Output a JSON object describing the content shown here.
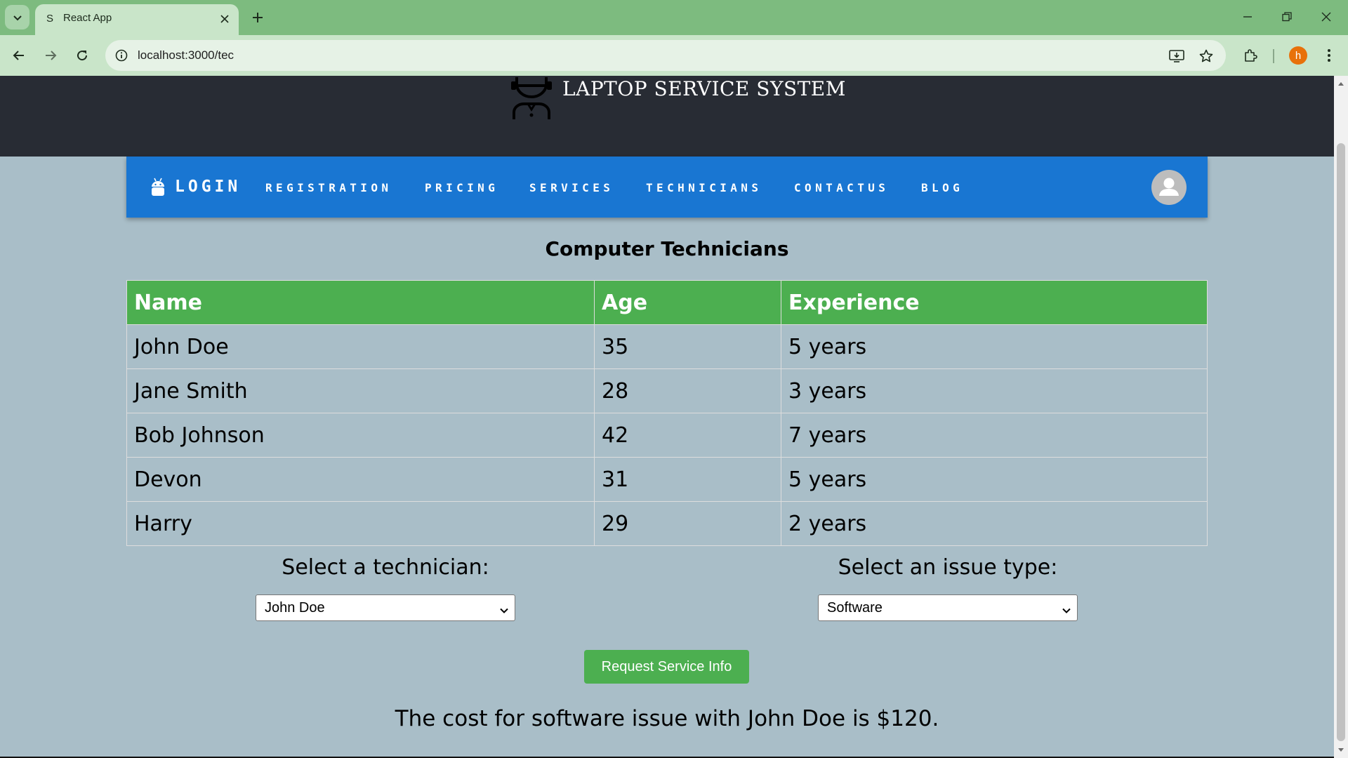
{
  "browser": {
    "tab_title": "React App",
    "tab_favicon": "S",
    "url": "localhost:3000/tec",
    "profile_initial": "h"
  },
  "site": {
    "title": "LAPTOP SERVICE SYSTEM"
  },
  "nav": {
    "login": "LOGIN",
    "links": [
      "REGISTRATION",
      "PRICING",
      "SERVICES",
      "TECHNICIANS",
      "CONTACTUS",
      "BLOG"
    ]
  },
  "page": {
    "heading": "Computer Technicians",
    "table": {
      "headers": [
        "Name",
        "Age",
        "Experience"
      ],
      "rows": [
        [
          "John Doe",
          "35",
          "5 years"
        ],
        [
          "Jane Smith",
          "28",
          "3 years"
        ],
        [
          "Bob Johnson",
          "42",
          "7 years"
        ],
        [
          "Devon",
          "31",
          "5 years"
        ],
        [
          "Harry",
          "29",
          "2 years"
        ]
      ]
    },
    "technician_label": "Select a technician:",
    "technician_selected": "John Doe",
    "issue_label": "Select an issue type:",
    "issue_selected": "Software",
    "request_button": "Request Service Info",
    "result_text": "The cost for software issue with John Doe is $120."
  },
  "colors": {
    "chrome_tabstrip": "#7dbb7f",
    "chrome_toolbar": "#c9e5c9",
    "header_bg": "#282c34",
    "navbar_bg": "#1976d2",
    "table_header_bg": "#4caf50",
    "page_bg": "#a9bec8",
    "button_bg": "#4caf50"
  },
  "icons": [
    "tab-search-icon",
    "close-icon",
    "plus-icon",
    "minimize-icon",
    "restore-icon",
    "back-icon",
    "forward-icon",
    "reload-icon",
    "site-info-icon",
    "install-app-icon",
    "bookmark-star-icon",
    "extensions-icon",
    "more-menu-icon",
    "technician-logo-icon",
    "android-icon",
    "user-avatar-icon",
    "chevron-down-icon"
  ]
}
